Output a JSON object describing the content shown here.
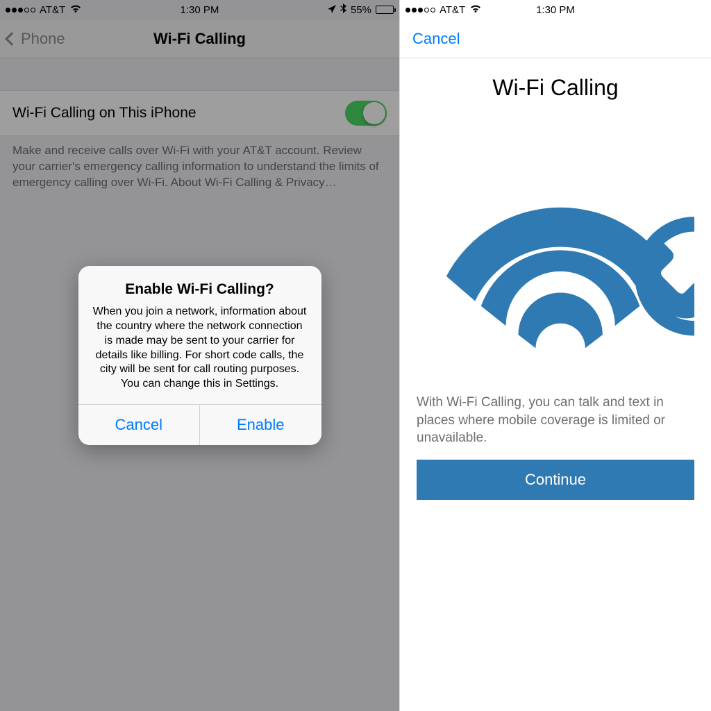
{
  "left": {
    "status": {
      "carrier": "AT&T",
      "time": "1:30 PM",
      "battery_pct": "55%",
      "signal_filled": 3,
      "signal_total": 5,
      "battery_fill_pct": 55
    },
    "nav": {
      "back_label": "Phone",
      "title": "Wi-Fi Calling"
    },
    "setting": {
      "label": "Wi-Fi Calling on This iPhone",
      "toggle_on": true,
      "footer": "Make and receive calls over Wi-Fi with your AT&T account. Review your carrier's emergency calling information to understand the limits of emergency calling over Wi-Fi. About Wi-Fi Calling & Privacy…"
    },
    "alert": {
      "title": "Enable Wi-Fi Calling?",
      "message": "When you join a network, information about the country where the network connection is made may be sent to your carrier for details like billing. For short code calls, the city will be sent for call routing purposes. You can change this in Settings.",
      "cancel": "Cancel",
      "enable": "Enable"
    }
  },
  "right": {
    "status": {
      "carrier": "AT&T",
      "time": "1:30 PM",
      "signal_filled": 3,
      "signal_total": 5
    },
    "cancel": "Cancel",
    "title": "Wi-Fi Calling",
    "desc": "With Wi-Fi Calling, you can talk and text in places where mobile coverage is limited or unavailable.",
    "continue": "Continue"
  },
  "colors": {
    "brand_blue": "#2f7ab2",
    "ios_blue": "#007aff",
    "toggle_green": "#4cd964"
  }
}
